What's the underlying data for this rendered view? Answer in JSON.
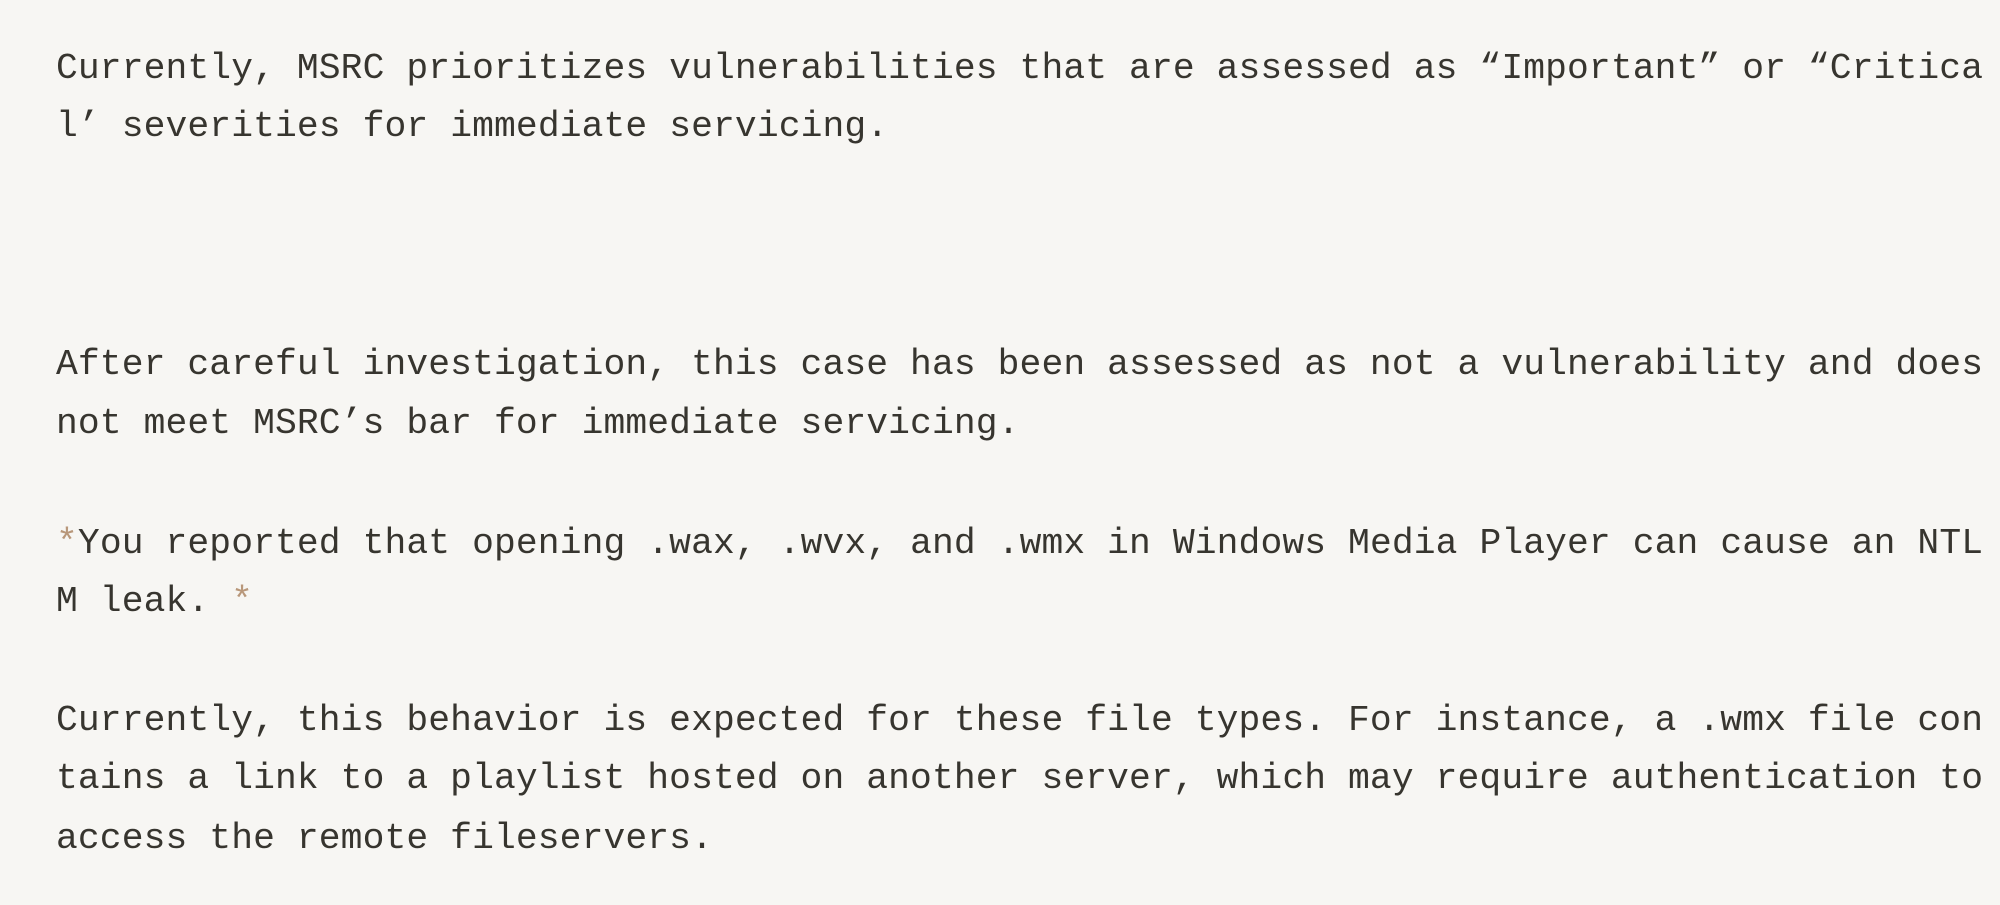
{
  "document": {
    "background": "#f7f6f3",
    "text_color": "#37352f",
    "marker_color": "#b8977a",
    "paragraphs": [
      {
        "lines": [
          "Currently, MSRC prioritizes vulnerabilities that are assessed as “Important” or “Critica",
          "l’ severities for immediate servicing."
        ]
      },
      {
        "lines": [
          "After careful investigation, this case has been assessed as not a vulnerability and does",
          "not meet MSRC’s bar for immediate servicing."
        ]
      },
      {
        "open_marker": "*",
        "lines": [
          "You reported that opening .wax, .wvx, and .wmx in Windows Media Player can cause an NTL",
          "M leak. "
        ],
        "close_marker": "*"
      },
      {
        "lines": [
          "Currently, this behavior is expected for these file types. For instance, a .wmx file con",
          "tains a link to a playlist hosted on another server, which may require authentication to",
          "access the remote fileservers."
        ]
      }
    ]
  }
}
